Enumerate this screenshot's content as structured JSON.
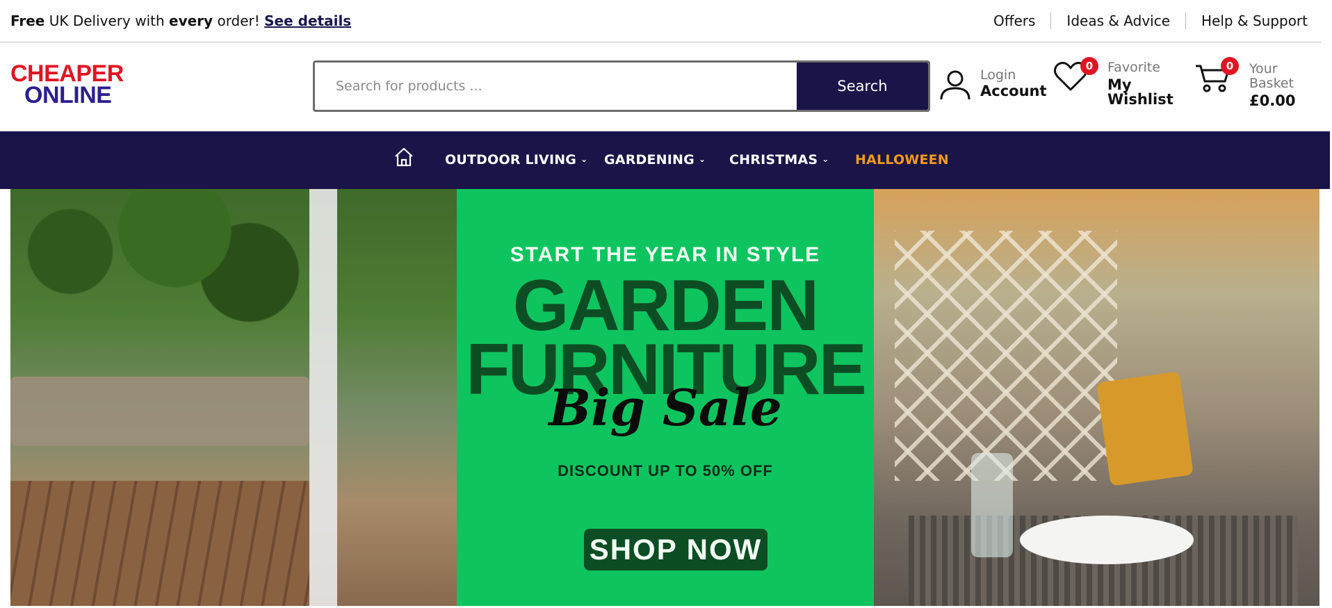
{
  "topbar": {
    "promo": {
      "part1_bold": "Free",
      "part2": " UK Delivery with ",
      "part3_bold": "every",
      "part4": " order! ",
      "link": "See details"
    },
    "links": [
      "Offers",
      "Ideas & Advice",
      "Help & Support"
    ]
  },
  "header": {
    "logo_line1": "CHEAPER",
    "logo_line2": "ONLINE",
    "search": {
      "placeholder": "Search for products ...",
      "button_label": "Search"
    },
    "account": {
      "small": "Login",
      "big": "Account"
    },
    "wishlist": {
      "badge": "0",
      "small": "Favorite",
      "big_line1": "My",
      "big_line2": "Wishlist"
    },
    "basket": {
      "badge": "0",
      "small_line1": "Your",
      "small_line2": "Basket",
      "total": "£0.00"
    }
  },
  "nav": {
    "items": [
      {
        "label": "OUTDOOR LIVING",
        "dropdown": true
      },
      {
        "label": "GARDENING",
        "dropdown": true
      },
      {
        "label": "CHRISTMAS",
        "dropdown": true
      },
      {
        "label": "HALLOWEEN",
        "dropdown": false
      }
    ],
    "highlight_color": "#f59a1b",
    "background_color": "#1b1448"
  },
  "hero": {
    "subtitle": "START THE YEAR IN STYLE",
    "title_line1": "GARDEN",
    "title_line2": "FURNITURE",
    "script": "Big Sale",
    "discount": "DISCOUNT UP TO 50% OFF",
    "cta": "SHOP NOW",
    "panel_color": "#0ec45f"
  }
}
